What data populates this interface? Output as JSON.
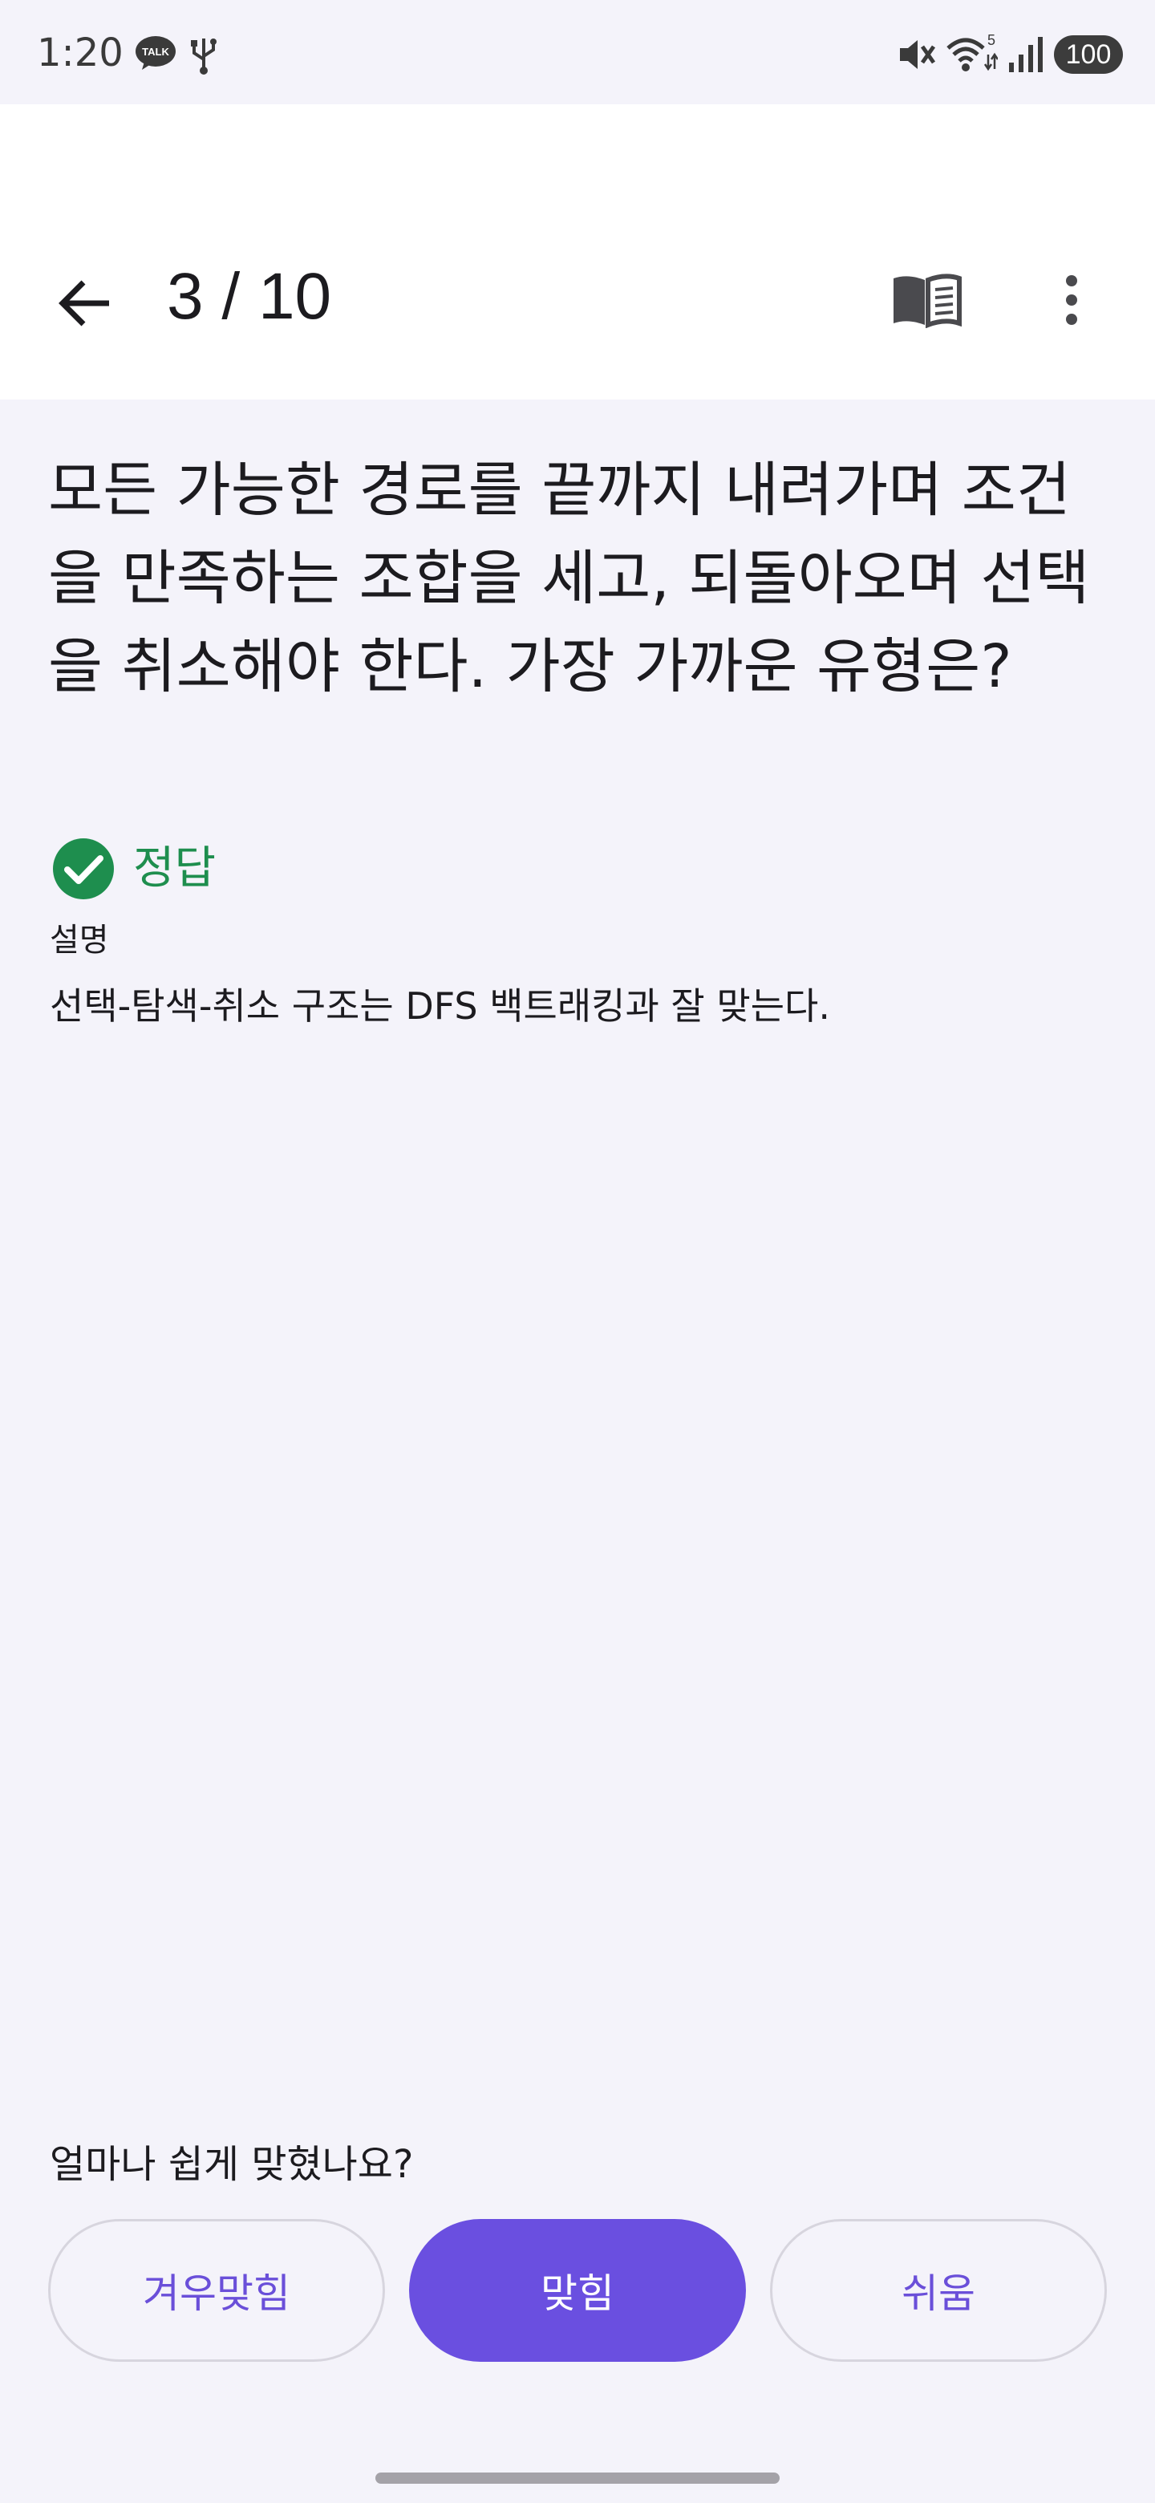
{
  "status_bar": {
    "time": "1:20",
    "talk_badge": "TALK",
    "wifi_badge": "5",
    "battery": "100"
  },
  "app_bar": {
    "progress": "3 / 10",
    "icons": {
      "back": "arrow-left-icon",
      "book": "book-icon",
      "more": "more-vert-icon"
    }
  },
  "question": {
    "text": "모든 가능한 경로를 끝까지 내려가며 조건을 만족하는 조합을 세고, 되돌아오며 선택을 취소해야 한다. 가장 가까운 유형은?"
  },
  "result": {
    "label": "정답",
    "icon": "check-circle-icon",
    "color": "#1E8E4E"
  },
  "explanation": {
    "label": "설명",
    "text": "선택-탐색-취소 구조는 DFS 백트래킹과 잘 맞는다."
  },
  "rating": {
    "prompt": "얼마나 쉽게 맞혔나요?",
    "options": [
      {
        "label": "겨우맞힘",
        "selected": false
      },
      {
        "label": "맞힘",
        "selected": true
      },
      {
        "label": "쉬움",
        "selected": false
      }
    ],
    "accent": "#6A4FE0"
  }
}
